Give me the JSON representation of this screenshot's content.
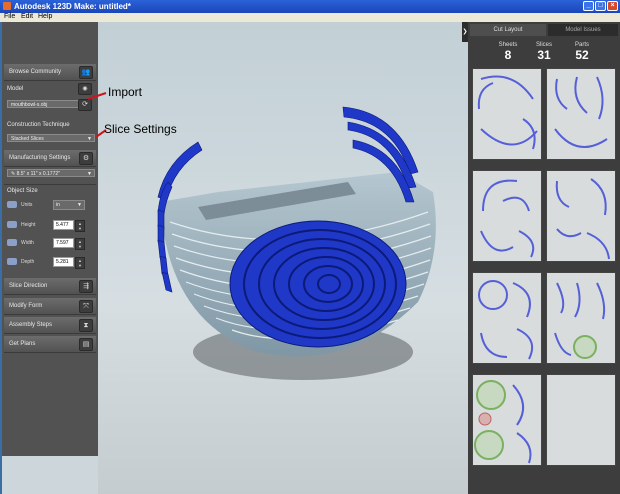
{
  "window": {
    "title": "Autodesk 123D Make: untitled*"
  },
  "menu": {
    "file": "File",
    "edit": "Edit",
    "help": "Help"
  },
  "sidebar": {
    "browse_community": "Browse Community",
    "model_label": "Model",
    "model_file": "mouthbowl-s.obj",
    "construction_label": "Construction Technique",
    "construction_value": "Stacked Slices",
    "manufacturing_label": "Manufacturing Settings",
    "manufacturing_value": "8.5\" x 11\" x 0.1772\"",
    "object_size_label": "Object Size",
    "units_label": "Units",
    "units_value": "in",
    "height_label": "Height",
    "height_value": "5.477",
    "width_label": "Width",
    "width_value": "7.597",
    "depth_label": "Depth",
    "depth_value": "5.281",
    "slice_direction": "Slice Direction",
    "modify_form": "Modify Form",
    "assembly_steps": "Assembly Steps",
    "get_plans": "Get Plans"
  },
  "annotations": {
    "import": "Import",
    "slice_settings": "Slice Settings"
  },
  "right_panel": {
    "tab_cut_layout": "Cut Layout",
    "tab_model_issues": "Model Issues",
    "sheets_label": "Sheets",
    "sheets_value": "8",
    "slices_label": "Slices",
    "slices_value": "31",
    "parts_label": "Parts",
    "parts_value": "52"
  },
  "colors": {
    "accent_annotation": "#d0141c",
    "slice_blue": "#1f38c8",
    "slice_gray": "#9fb3c0",
    "sidebar_bg": "#525252"
  }
}
